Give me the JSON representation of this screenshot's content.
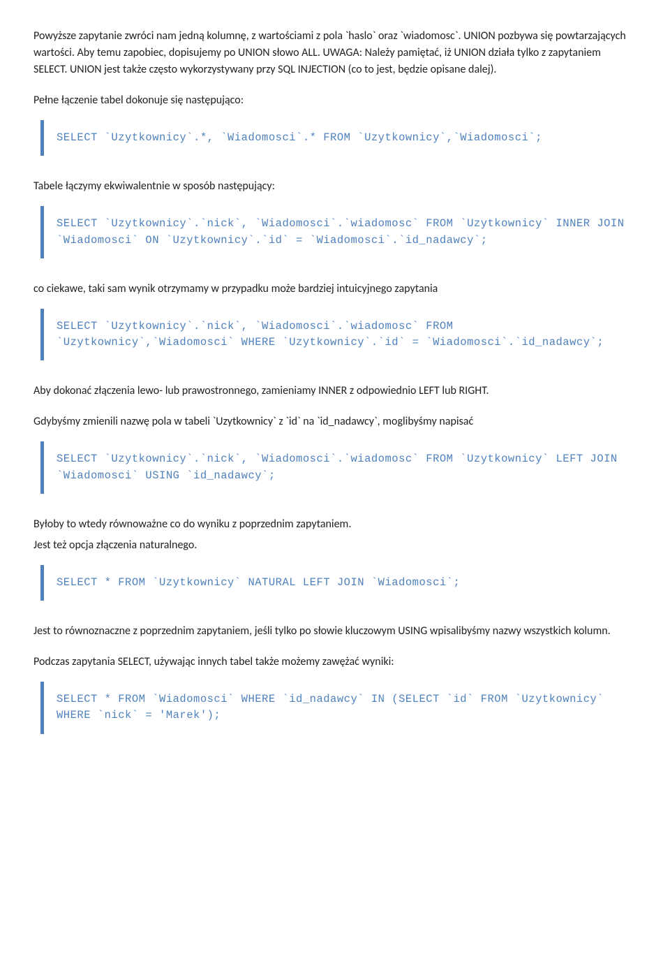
{
  "p1": "Powyższe zapytanie zwróci nam jedną kolumnę, z wartościami z pola `haslo` oraz `wiadomosc`. UNION pozbywa się powtarzających wartości. Aby temu zapobiec, dopisujemy po UNION słowo ALL. UWAGA: Należy pamiętać, iż UNION działa tylko z zapytaniem SELECT. UNION jest także często wykorzystywany przy SQL INJECTION (co to jest, będzie opisane dalej).",
  "p2": "Pełne łączenie tabel dokonuje się następująco:",
  "code1": "SELECT `Uzytkownicy`.*, `Wiadomosci`.* FROM `Uzytkownicy`,`Wiadomosci`;",
  "p3": "Tabele łączymy ekwiwalentnie w sposób następujący:",
  "code2": "SELECT `Uzytkownicy`.`nick`, `Wiadomosci`.`wiadomosc` FROM `Uzytkownicy` INNER JOIN `Wiadomosci` ON `Uzytkownicy`.`id` = `Wiadomosci`.`id_nadawcy`;",
  "p4": "co ciekawe, taki sam wynik otrzymamy w przypadku może bardziej intuicyjnego zapytania",
  "code3": "SELECT `Uzytkownicy`.`nick`, `Wiadomosci`.`wiadomosc` FROM `Uzytkownicy`,`Wiadomosci` WHERE `Uzytkownicy`.`id` = `Wiadomosci`.`id_nadawcy`;",
  "p5": "Aby dokonać złączenia lewo- lub prawostronnego, zamieniamy INNER z odpowiednio LEFT lub RIGHT.",
  "p6": "Gdybyśmy zmienili nazwę pola w tabeli `Uzytkownicy` z `id` na `id_nadawcy`, moglibyśmy napisać",
  "code4": "SELECT `Uzytkownicy`.`nick`, `Wiadomosci`.`wiadomosc` FROM `Uzytkownicy` LEFT JOIN `Wiadomosci` USING `id_nadawcy`;",
  "p7": "Byłoby to wtedy równoważne co do wyniku z poprzednim zapytaniem.",
  "p8": "Jest też opcja złączenia naturalnego.",
  "code5": "SELECT * FROM `Uzytkownicy` NATURAL LEFT JOIN `Wiadomosci`;",
  "p9": "Jest to równoznaczne z poprzednim zapytaniem, jeśli tylko po słowie kluczowym USING wpisalibyśmy nazwy wszystkich kolumn.",
  "p10": "Podczas zapytania SELECT, używając innych tabel także możemy zawężać wyniki:",
  "code6": "SELECT * FROM `Wiadomosci` WHERE `id_nadawcy` IN (SELECT `id` FROM `Uzytkownicy` WHERE `nick` = 'Marek');"
}
